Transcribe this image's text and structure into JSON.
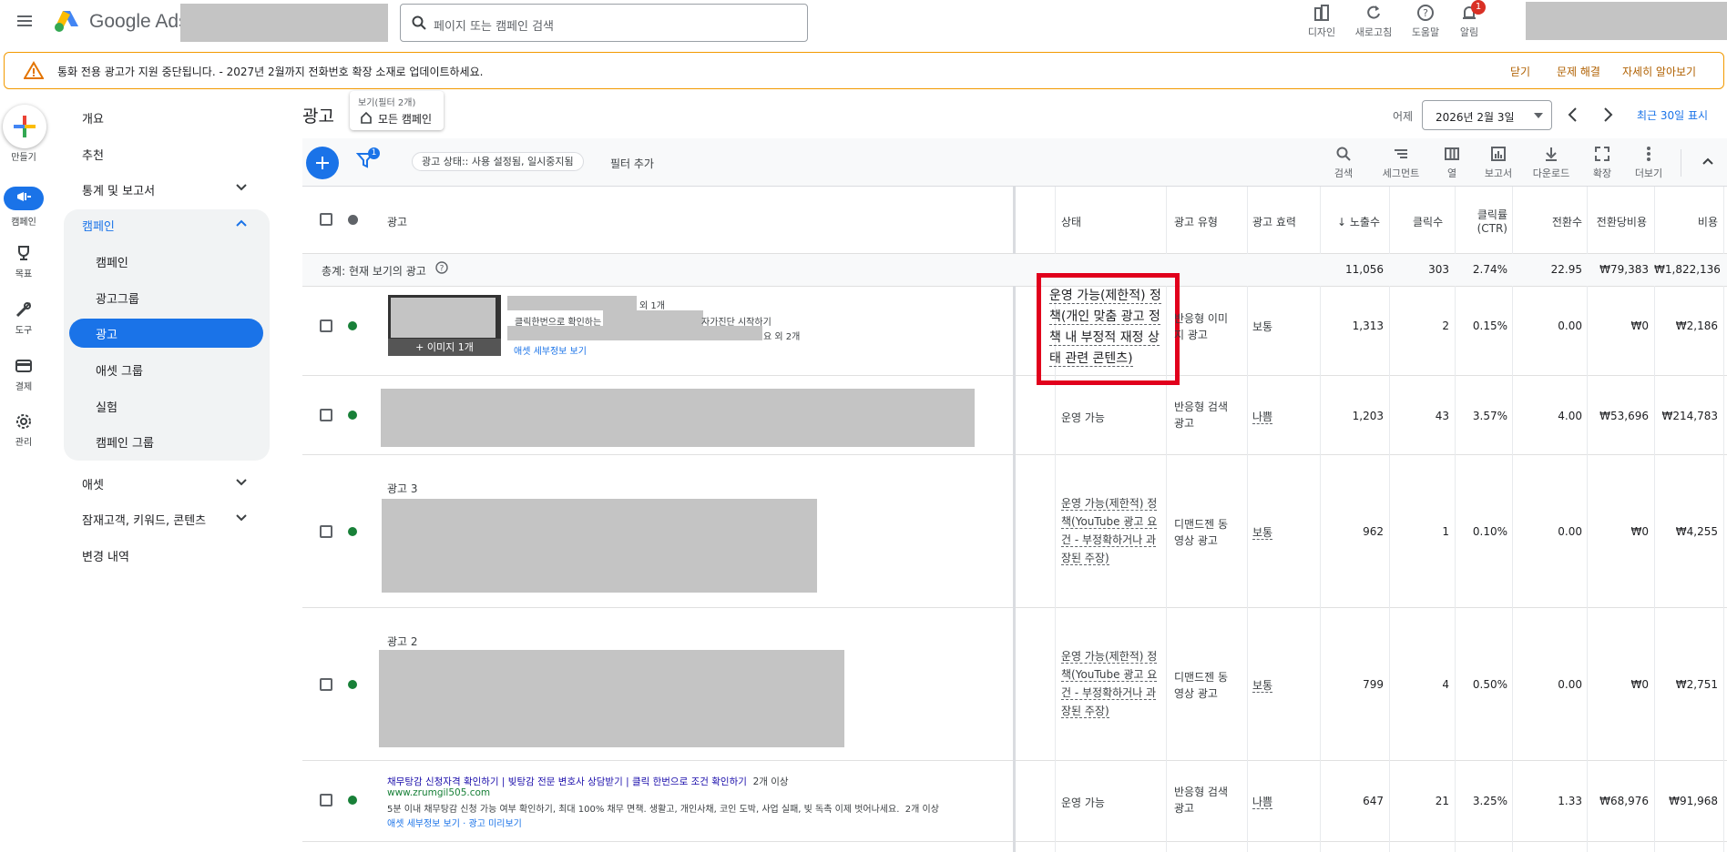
{
  "topbar": {
    "app_name": "Google Ads",
    "search_placeholder": "페이지 또는 캠페인 검색",
    "tools": [
      "디자인",
      "새로고침",
      "도움말",
      "알림"
    ],
    "notification_count": "1"
  },
  "banner": {
    "message": "통화 전용 광고가 지원 중단됩니다. - 2027년 2월까지 전화번호 확장 소재로 업데이트하세요.",
    "actions": [
      "닫기",
      "문제 해결",
      "자세히 알아보기"
    ]
  },
  "rail": {
    "items": [
      "만들기",
      "캠페인",
      "목표",
      "도구",
      "결제",
      "관리"
    ]
  },
  "nav": {
    "items": [
      "개요",
      "추천",
      "통계 및 보고서",
      "캠페인",
      "애셋",
      "잠재고객, 키워드, 콘텐츠",
      "변경 내역"
    ],
    "sub_items": [
      "캠페인",
      "광고그룹",
      "광고",
      "애셋 그룹",
      "실험",
      "캠페인 그룹"
    ]
  },
  "header": {
    "title": "광고",
    "view_label": "보기(필터 2개)",
    "view_value": "모든 캠페인",
    "date_prefix": "어제",
    "date_value": "2026년 2월 3일",
    "range_link": "최근 30일 표시"
  },
  "toolbar": {
    "filter_badge": "1",
    "filter_chip": "광고 상태:: 사용 설정됨, 일시중지됨",
    "add_filter": "필터 추가",
    "tools": [
      "검색",
      "세그먼트",
      "열",
      "보고서",
      "다운로드",
      "확장",
      "더보기"
    ]
  },
  "table": {
    "headers": {
      "ad": "광고",
      "status": "상태",
      "type": "광고 유형",
      "strength": "광고 효력",
      "impressions": "노출수",
      "clicks": "클릭수",
      "ctr_line1": "클릭률",
      "ctr_line2": "(CTR)",
      "conversions": "전환수",
      "cost_per_conv": "전환당비용",
      "cost": "비용"
    },
    "total": {
      "label": "총계: 현재 보기의 광고",
      "impressions": "11,056",
      "clicks": "303",
      "ctr": "2.74%",
      "conversions": "22.95",
      "cost_per_conv": "₩79,383",
      "cost": "₩1,822,136"
    },
    "rows": [
      {
        "image_caption": "+ 이미지 1개",
        "line1_tail": "외 1개",
        "line2_head": "클릭한번으로 확인하는",
        "line2_tail": "자가진단 시작하기",
        "line3_tail": "요 외 2개",
        "asset_link": "애셋 세부정보 보기",
        "status": "운영 가능(제한적) 정책(개인 맞춤 광고 정책 내 부정적 재정 상태 관련 콘텐츠)",
        "type": "반응형 이미지 광고",
        "strength": "보통",
        "impressions": "1,313",
        "clicks": "2",
        "ctr": "0.15%",
        "conversions": "0.00",
        "cost_per_conv": "₩0",
        "cost": "₩2,186"
      },
      {
        "status": "운영 가능",
        "type": "반응형 검색 광고",
        "strength": "나쁨",
        "impressions": "1,203",
        "clicks": "43",
        "ctr": "3.57%",
        "conversions": "4.00",
        "cost_per_conv": "₩53,696",
        "cost": "₩214,783"
      },
      {
        "name": "광고 3",
        "status": "운영 가능(제한적) 정책(YouTube 광고 요건 - 부정확하거나 과장된 주장)",
        "type": "디맨드젠 동영상 광고",
        "strength": "보통",
        "impressions": "962",
        "clicks": "1",
        "ctr": "0.10%",
        "conversions": "0.00",
        "cost_per_conv": "₩0",
        "cost": "₩4,255"
      },
      {
        "name": "광고 2",
        "status": "운영 가능(제한적) 정책(YouTube 광고 요건 - 부정확하거나 과장된 주장)",
        "type": "디맨드젠 동영상 광고",
        "strength": "보통",
        "impressions": "799",
        "clicks": "4",
        "ctr": "0.50%",
        "conversions": "0.00",
        "cost_per_conv": "₩0",
        "cost": "₩2,751"
      },
      {
        "headline": "채무탕감 신청자격 확인하기 | 빚탕감 전문 변호사 상담받기 | 클릭 한번으로 조건 확인하기",
        "headline_more": "2개 이상",
        "url": "www.zrumgil505.com",
        "description": "5분 이내 채무탕감 신청 가능 여부 확인하기, 최대 100% 채무 면책. 생활고, 개인사채, 코인 도박, 사업 실패, 빚 독촉 이제 벗어나세요.",
        "description_more": "2개 이상",
        "links": "애셋 세부정보 보기 · 광고 미리보기",
        "status": "운영 가능",
        "type": "반응형 검색 광고",
        "strength": "나쁨",
        "impressions": "647",
        "clicks": "21",
        "ctr": "3.25%",
        "conversions": "1.33",
        "cost_per_conv": "₩68,976",
        "cost": "₩91,968"
      }
    ]
  }
}
